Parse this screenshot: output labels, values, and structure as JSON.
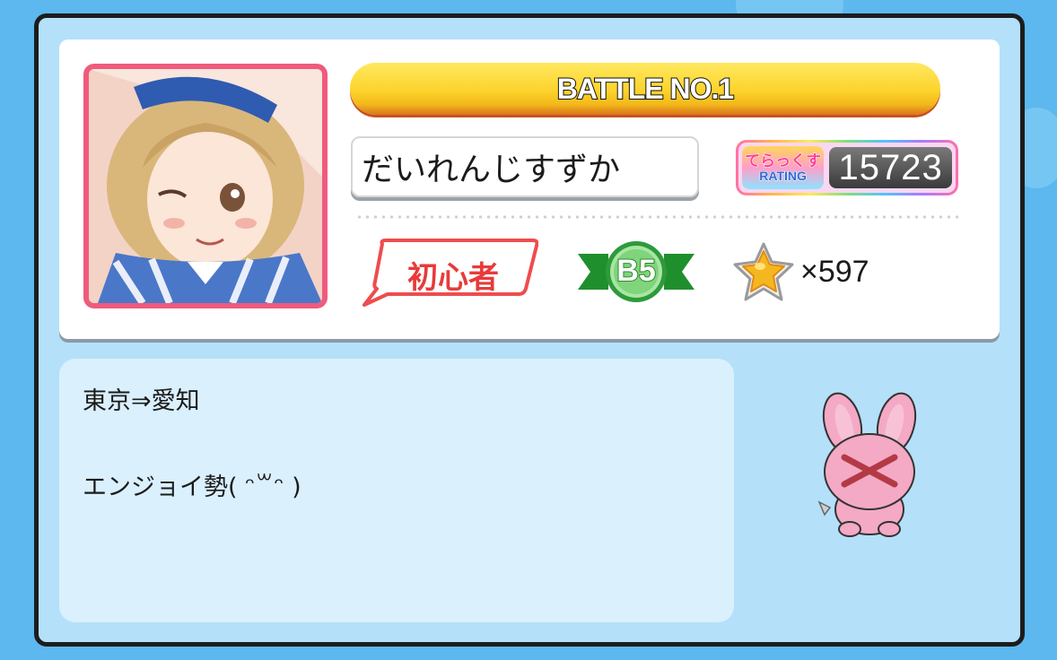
{
  "profile": {
    "title": "BATTLE NO.1",
    "player_name": "だいれんじすずか",
    "rating": {
      "logo_top": "てらっくす",
      "logo_bottom": "RATING",
      "value": "15723"
    },
    "title_badge": "初心者",
    "rank": "B5",
    "stars": "×597"
  },
  "comment": {
    "line1": "東京⇒愛知",
    "line2": "エンジョイ勢( ᵔ꒳ᵔ )"
  },
  "colors": {
    "background": "#5cb8ee",
    "panel": "#b4e0fa",
    "banner": "#fcd32a",
    "avatar_border": "#ef5b7c",
    "beginner_red": "#e83a3a",
    "rank_green": "#2e8a2e"
  },
  "icons": {
    "avatar": "character-portrait",
    "star": "star-icon",
    "mascot": "pink-rabbit-mascot"
  }
}
